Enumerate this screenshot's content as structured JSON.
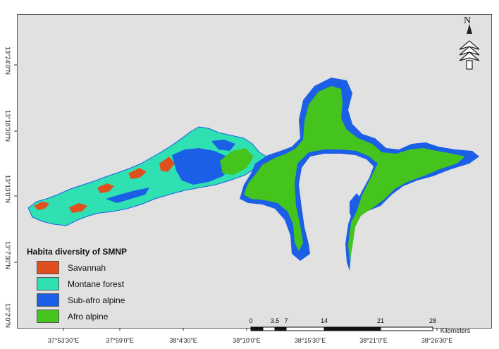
{
  "legend": {
    "title": "Habita diversity of SMNP",
    "items": [
      {
        "label": "Savannah",
        "color": "#e0501f"
      },
      {
        "label": "Montane forest",
        "color": "#2fe0b2"
      },
      {
        "label": "Sub-afro alpine",
        "color": "#1a5fe6"
      },
      {
        "label": "Afro alpine",
        "color": "#45c41e"
      }
    ]
  },
  "north_arrow": {
    "letter": "N"
  },
  "latitude_labels": [
    "13°24'0\"N",
    "13°18'30\"N",
    "13°13'0\"N",
    "13°7'30\"N",
    "13°2'0\"N"
  ],
  "longitude_labels": [
    "37°53'30\"E",
    "37°59'0\"E",
    "38°4'30\"E",
    "38°10'0\"E",
    "38°15'30\"E",
    "38°21'0\"E",
    "38°26'30\"E"
  ],
  "scale_bar": {
    "ticks": [
      "0",
      "3.5",
      "7",
      "14",
      "21",
      "28"
    ],
    "unit": "Kilometers"
  }
}
